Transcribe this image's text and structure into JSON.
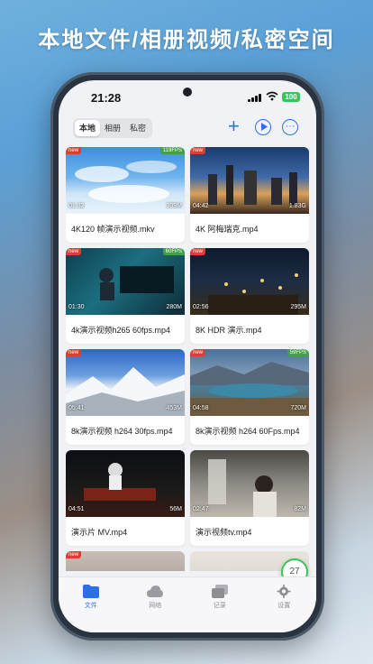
{
  "headline": "本地文件/相册视频/私密空间",
  "status": {
    "time": "21:28",
    "battery": "100"
  },
  "segments": [
    {
      "label": "本地",
      "active": true
    },
    {
      "label": "相册",
      "active": false
    },
    {
      "label": "私密",
      "active": false
    }
  ],
  "toolbar": {
    "add_icon": "plus-icon",
    "play_icon": "play-circle-icon",
    "more_icon": "ellipsis-circle-icon"
  },
  "videos": [
    {
      "title": "4K120 帧演示视频.mkv",
      "duration": "01:32",
      "size": "309M",
      "new": "new",
      "fps": "119FPS"
    },
    {
      "title": "4K 阿梅瑞克.mp4",
      "duration": "04:42",
      "size": "1.83G",
      "new": "new",
      "fps": ""
    },
    {
      "title": "4k演示视频h265 60fps.mp4",
      "duration": "01:30",
      "size": "280M",
      "new": "new",
      "fps": "60FPS"
    },
    {
      "title": "8K HDR 演示.mp4",
      "duration": "02:56",
      "size": "295M",
      "new": "new",
      "fps": ""
    },
    {
      "title": "8k演示视频 h264 30fps.mp4",
      "duration": "05:41",
      "size": "453M",
      "new": "new",
      "fps": ""
    },
    {
      "title": "8k演示视频 h264 60Fps.mp4",
      "duration": "04:58",
      "size": "720M",
      "new": "new",
      "fps": "59FPS"
    },
    {
      "title": "演示片 MV.mp4",
      "duration": "04:51",
      "size": "56M",
      "new": "",
      "fps": ""
    },
    {
      "title": "演示视频tv.mp4",
      "duration": "02:47",
      "size": "82M",
      "new": "",
      "fps": ""
    },
    {
      "title": "",
      "duration": "",
      "size": "",
      "new": "new",
      "fps": ""
    },
    {
      "title": "",
      "duration": "",
      "size": "",
      "new": "",
      "fps": ""
    }
  ],
  "fab_count": "27",
  "tabs": [
    {
      "label": "文件",
      "icon": "folder-icon",
      "active": true
    },
    {
      "label": "网络",
      "icon": "cloud-icon",
      "active": false
    },
    {
      "label": "记录",
      "icon": "history-icon",
      "active": false
    },
    {
      "label": "设置",
      "icon": "gear-icon",
      "active": false
    }
  ],
  "colors": {
    "accent": "#2f6fe6",
    "new_badge": "#e53935",
    "fps_badge": "#43a047",
    "battery": "#35c759"
  }
}
